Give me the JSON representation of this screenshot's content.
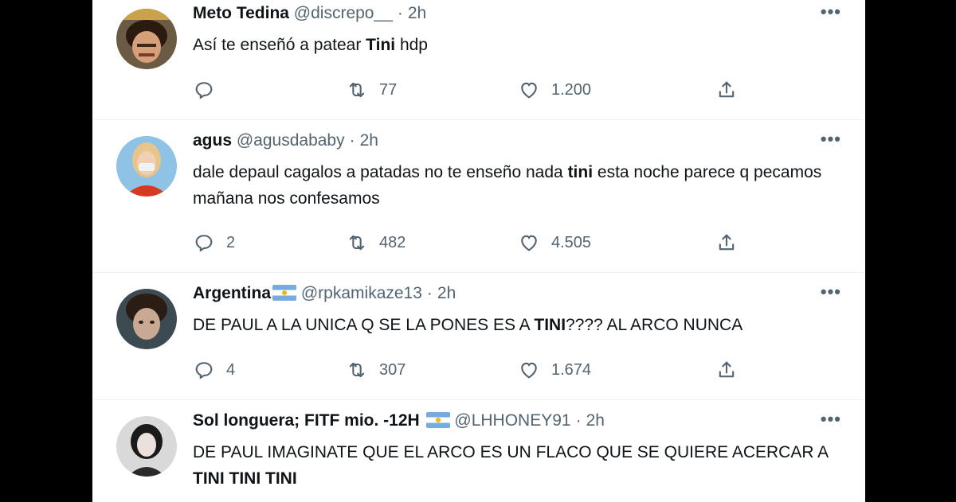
{
  "tweets": [
    {
      "name": "Meto Tedina",
      "handle": "@discrepo__",
      "time": "2h",
      "text_parts": [
        "Así te enseñó a patear ",
        "Tini",
        " hdp"
      ],
      "replies": "",
      "retweets": "77",
      "likes": "1.200"
    },
    {
      "name": "agus",
      "handle": "@agusdababy",
      "time": "2h",
      "text_parts": [
        "dale depaul cagalos a patadas no te enseño nada ",
        "tini",
        " esta noche parece q pecamos mañana nos confesamos"
      ],
      "replies": "2",
      "retweets": "482",
      "likes": "4.505"
    },
    {
      "name": "Argentina",
      "handle": "@rpkamikaze13",
      "time": "2h",
      "text_parts": [
        "DE PAUL A LA UNICA Q SE LA PONES ES A ",
        "TINI",
        "???? AL ARCO NUNCA"
      ],
      "replies": "4",
      "retweets": "307",
      "likes": "1.674"
    },
    {
      "name": "Sol longuera; FITF mio. -12H",
      "handle": "@LHHONEY91",
      "time": "2h",
      "text_parts": [
        "DE PAUL IMAGINATE QUE EL ARCO ES UN FLACO QUE SE QUIERE ACERCAR A ",
        "TINI TINI TINI",
        ""
      ]
    }
  ],
  "ui": {
    "more": "•••",
    "dot": "·"
  },
  "colors": {
    "secondary_text": "#536471",
    "primary_text": "#0f1419",
    "divider": "#eff3f4"
  }
}
